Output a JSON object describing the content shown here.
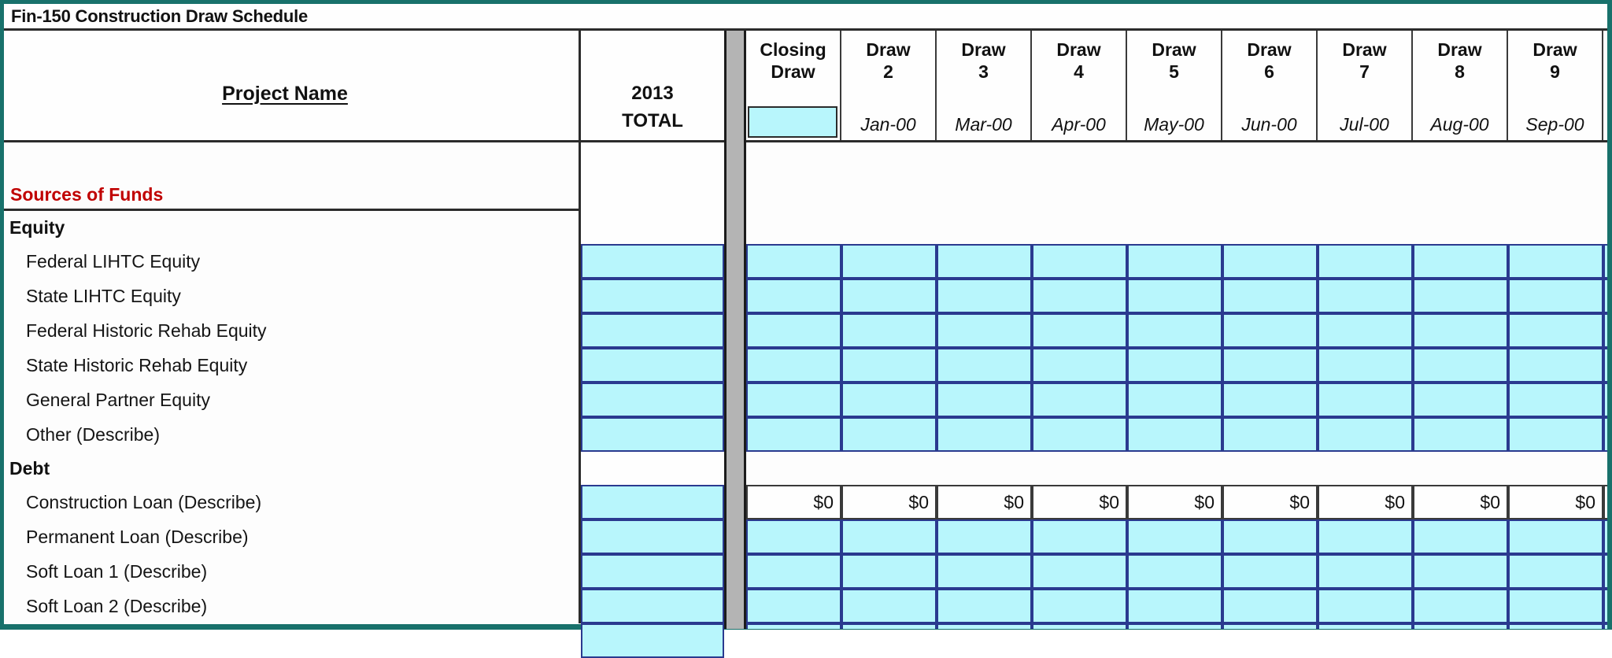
{
  "document": {
    "title": "Fin-150 Construction Draw Schedule",
    "accent_teal": "#18716b",
    "fill_cyan": "#b8f6fc",
    "section_red": "#c00000"
  },
  "header": {
    "project_name_label": "Project Name ",
    "total_year": "2013",
    "total_word": "TOTAL",
    "draw_columns": [
      {
        "label": "Closing",
        "number": "Draw",
        "date": ""
      },
      {
        "label": "Draw",
        "number": "2",
        "date": "Jan-00"
      },
      {
        "label": "Draw",
        "number": "3",
        "date": "Mar-00"
      },
      {
        "label": "Draw",
        "number": "4",
        "date": "Apr-00"
      },
      {
        "label": "Draw",
        "number": "5",
        "date": "May-00"
      },
      {
        "label": "Draw",
        "number": "6",
        "date": "Jun-00"
      },
      {
        "label": "Draw",
        "number": "7",
        "date": "Jul-00"
      },
      {
        "label": "Draw",
        "number": "8",
        "date": "Aug-00"
      },
      {
        "label": "Draw",
        "number": "9",
        "date": "Sep-00"
      }
    ]
  },
  "rows": [
    {
      "label": "Sources of Funds",
      "kind": "section"
    },
    {
      "label": "Equity",
      "kind": "group"
    },
    {
      "label": "Federal LIHTC Equity",
      "kind": "item"
    },
    {
      "label": "State LIHTC Equity",
      "kind": "item"
    },
    {
      "label": "Federal Historic Rehab Equity",
      "kind": "item"
    },
    {
      "label": "State Historic Rehab Equity",
      "kind": "item"
    },
    {
      "label": "General Partner Equity",
      "kind": "item"
    },
    {
      "label": "Other (Describe)",
      "kind": "item"
    },
    {
      "label": "Debt",
      "kind": "group"
    },
    {
      "label": "Construction Loan (Describe)",
      "kind": "item"
    },
    {
      "label": "Permanent Loan (Describe)",
      "kind": "item"
    },
    {
      "label": "Soft Loan 1 (Describe)",
      "kind": "item"
    },
    {
      "label": "Soft Loan 2 (Describe)",
      "kind": "item"
    }
  ],
  "values": {
    "construction_loan": [
      "$0",
      "$0",
      "$0",
      "$0",
      "$0",
      "$0",
      "$0",
      "$0",
      "$0"
    ]
  }
}
